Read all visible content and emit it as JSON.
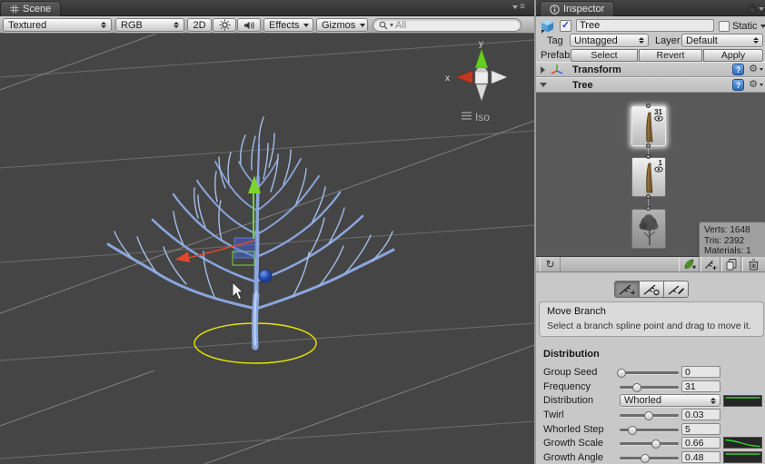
{
  "scene_panel": {
    "tab": "Scene",
    "toolbar": {
      "shading_mode": "Textured",
      "channel": "RGB",
      "mode_2d": "2D",
      "effects": "Effects",
      "gizmos": "Gizmos",
      "search_placeholder": "All"
    },
    "view_gizmo": {
      "axis_y": "y",
      "axis_x": "x",
      "projection": "Iso"
    }
  },
  "inspector": {
    "tab": "Inspector",
    "header": {
      "name": "Tree",
      "static_label": "Static",
      "tag_label": "Tag",
      "tag_value": "Untagged",
      "layer_label": "Layer",
      "layer_value": "Default",
      "prefab": {
        "label": "Prefab",
        "select": "Select",
        "revert": "Revert",
        "apply": "Apply"
      }
    },
    "components": {
      "transform": "Transform",
      "tree": "Tree"
    },
    "tree_editor": {
      "nodes": [
        {
          "count": "31"
        },
        {
          "count": "1"
        },
        {
          "count": ""
        }
      ],
      "stats": {
        "verts": "Verts: 1648",
        "tris": "Tris: 2392",
        "materials": "Materials: 1"
      }
    },
    "tool_help": {
      "title": "Move Branch",
      "description": "Select a branch spline point and drag to move it."
    },
    "distribution": {
      "header": "Distribution",
      "rows": [
        {
          "label": "Group Seed",
          "value": "0",
          "fraction": 0.03
        },
        {
          "label": "Frequency",
          "value": "31",
          "fraction": 0.29
        },
        {
          "label": "Distribution",
          "value": "Whorled"
        },
        {
          "label": "Twirl",
          "value": "0.03",
          "fraction": 0.49
        },
        {
          "label": "Whorled Step",
          "value": "5",
          "fraction": 0.22
        },
        {
          "label": "Growth Scale",
          "value": "0.66",
          "fraction": 0.62
        },
        {
          "label": "Growth Angle",
          "value": "0.48",
          "fraction": 0.43
        }
      ]
    }
  },
  "icons": {
    "gear": "⚙",
    "refresh": "↻",
    "menu": "≡",
    "check": "✓"
  },
  "colors": {
    "accent_green": "#2fd42f",
    "gizmo_green": "#7cd42f",
    "gizmo_red": "#e0482b",
    "selection_yellow": "#e6e600",
    "branch_blue": "#8aa6de"
  }
}
